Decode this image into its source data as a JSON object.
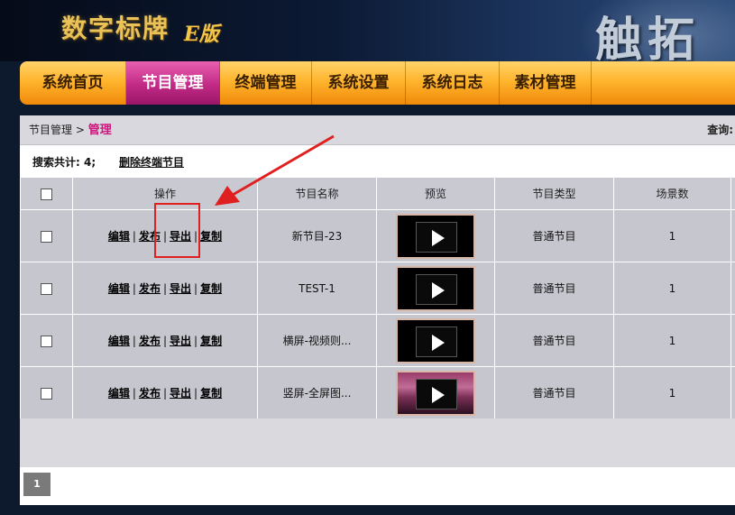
{
  "header": {
    "brand": "数字标牌",
    "edition": "E版",
    "company": "触拓"
  },
  "nav": {
    "items": [
      {
        "label": "系统首页",
        "active": false
      },
      {
        "label": "节目管理",
        "active": true
      },
      {
        "label": "终端管理",
        "active": false
      },
      {
        "label": "系统设置",
        "active": false
      },
      {
        "label": "系统日志",
        "active": false
      },
      {
        "label": "素材管理",
        "active": false
      }
    ]
  },
  "breadcrumb": {
    "parent": "节目管理",
    "separator": " > ",
    "current": "管理",
    "query_label": "查询:"
  },
  "info": {
    "count_text": "搜索共计: 4;",
    "delete_link": "删除终端节目"
  },
  "table": {
    "headers": [
      "操作",
      "节目名称",
      "预览",
      "节目类型",
      "场景数"
    ],
    "ops": [
      "编辑",
      "发布",
      "导出",
      "复制"
    ],
    "rows": [
      {
        "name": "新节目-23",
        "type": "普通节目",
        "scenes": "1",
        "thumb": "black"
      },
      {
        "name": "TEST-1",
        "type": "普通节目",
        "scenes": "1",
        "thumb": "black"
      },
      {
        "name": "横屏-视频则...",
        "type": "普通节目",
        "scenes": "1",
        "thumb": "black"
      },
      {
        "name": "竖屏-全屏图...",
        "type": "普通节目",
        "scenes": "1",
        "thumb": "pink"
      }
    ]
  },
  "pagination": {
    "current_page": "1"
  },
  "colors": {
    "nav_active": "#c12a86",
    "nav_bg": "#ffb52e",
    "crumb_active": "#d4147e",
    "annotation": "#e02020"
  },
  "icons": {
    "preview": "play-icon",
    "annotation": "arrow-icon"
  }
}
